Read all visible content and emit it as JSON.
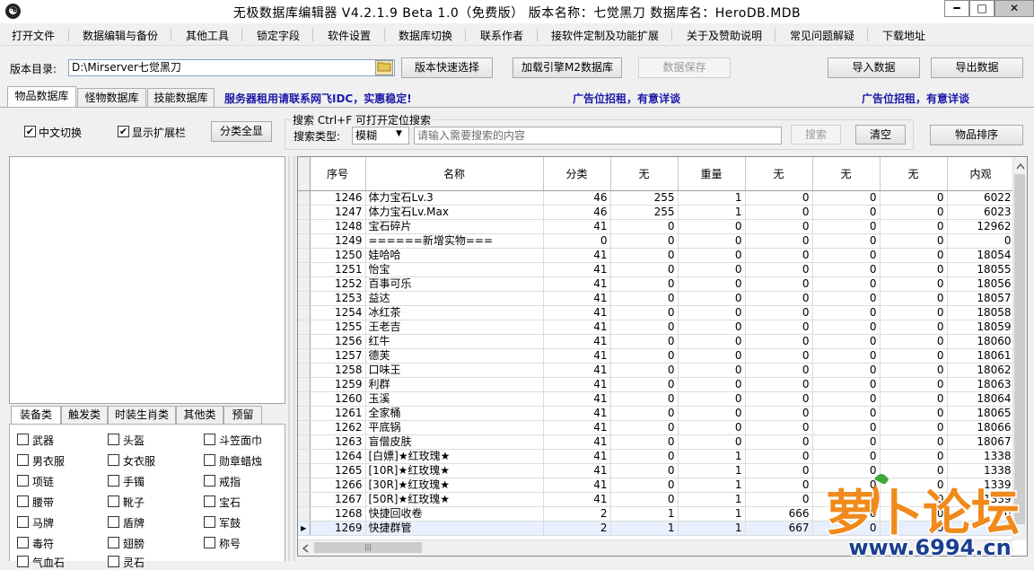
{
  "window": {
    "title": "无极数据库编辑器 V4.2.1.9    Beta 1.0（免费版）    版本名称：七觉黑刀    数据库名：HeroDB.MDB",
    "icon_char": "☯",
    "minimize": "━",
    "maximize": "□",
    "close": "✕"
  },
  "menu": [
    "打开文件",
    "数据编辑与备份",
    "其他工具",
    "锁定字段",
    "软件设置",
    "数据库切换",
    "联系作者",
    "接软件定制及功能扩展",
    "关于及赞助说明",
    "常见问题解疑",
    "下载地址"
  ],
  "toolbar": {
    "dir_label": "版本目录:",
    "dir_value": "D:\\Mirserver七觉黑刀",
    "quick_select": "版本快速选择",
    "load_engine": "加载引擎M2数据库",
    "save_data": "数据保存",
    "import_data": "导入数据",
    "export_data": "导出数据"
  },
  "tabs": [
    "物品数据库",
    "怪物数据库",
    "技能数据库"
  ],
  "ads": [
    "服务器租用请联系网飞IDC，实惠稳定!",
    "广告位招租，有意详谈",
    "广告位招租，有意详谈"
  ],
  "options": {
    "chinese_switch": "中文切换",
    "show_ext": "显示扩展栏",
    "show_all": "分类全显",
    "check_mark": "✔"
  },
  "search": {
    "legend": "搜索  Ctrl+F 可打开定位搜索",
    "type_label": "搜索类型:",
    "type_value": "模糊",
    "placeholder": "请输入需要搜索的内容",
    "search_button": "搜索",
    "clear_button": "清空",
    "sort_button": "物品排序"
  },
  "category_tabs": [
    "装备类",
    "触发类",
    "时装生肖类",
    "其他类",
    "预留"
  ],
  "categories": [
    "武器",
    "头盔",
    "斗笠面巾",
    "男衣服",
    "女衣服",
    "勋章蜡烛",
    "项链",
    "手镯",
    "戒指",
    "腰带",
    "靴子",
    "宝石",
    "马牌",
    "盾牌",
    "军鼓",
    "毒符",
    "翅膀",
    "称号",
    "气血石",
    "灵石"
  ],
  "grid": {
    "columns": [
      "序号",
      "名称",
      "分类",
      "无",
      "重量",
      "无",
      "无",
      "无",
      "内观"
    ],
    "selected_row_marker": "▶",
    "rows": [
      [
        "1246",
        "体力宝石Lv.3",
        "46",
        "255",
        "1",
        "0",
        "0",
        "0",
        "6022"
      ],
      [
        "1247",
        "体力宝石Lv.Max",
        "46",
        "255",
        "1",
        "0",
        "0",
        "0",
        "6023"
      ],
      [
        "1248",
        "宝石碎片",
        "41",
        "0",
        "0",
        "0",
        "0",
        "0",
        "12962"
      ],
      [
        "1249",
        "======新增实物===",
        "0",
        "0",
        "0",
        "0",
        "0",
        "0",
        "0"
      ],
      [
        "1250",
        "娃哈哈",
        "41",
        "0",
        "0",
        "0",
        "0",
        "0",
        "18054"
      ],
      [
        "1251",
        "怡宝",
        "41",
        "0",
        "0",
        "0",
        "0",
        "0",
        "18055"
      ],
      [
        "1252",
        "百事可乐",
        "41",
        "0",
        "0",
        "0",
        "0",
        "0",
        "18056"
      ],
      [
        "1253",
        "益达",
        "41",
        "0",
        "0",
        "0",
        "0",
        "0",
        "18057"
      ],
      [
        "1254",
        "冰红茶",
        "41",
        "0",
        "0",
        "0",
        "0",
        "0",
        "18058"
      ],
      [
        "1255",
        "王老吉",
        "41",
        "0",
        "0",
        "0",
        "0",
        "0",
        "18059"
      ],
      [
        "1256",
        "红牛",
        "41",
        "0",
        "0",
        "0",
        "0",
        "0",
        "18060"
      ],
      [
        "1257",
        "德芙",
        "41",
        "0",
        "0",
        "0",
        "0",
        "0",
        "18061"
      ],
      [
        "1258",
        "口味王",
        "41",
        "0",
        "0",
        "0",
        "0",
        "0",
        "18062"
      ],
      [
        "1259",
        "利群",
        "41",
        "0",
        "0",
        "0",
        "0",
        "0",
        "18063"
      ],
      [
        "1260",
        "玉溪",
        "41",
        "0",
        "0",
        "0",
        "0",
        "0",
        "18064"
      ],
      [
        "1261",
        "全家桶",
        "41",
        "0",
        "0",
        "0",
        "0",
        "0",
        "18065"
      ],
      [
        "1262",
        "平底锅",
        "41",
        "0",
        "0",
        "0",
        "0",
        "0",
        "18066"
      ],
      [
        "1263",
        "盲僧皮肤",
        "41",
        "0",
        "0",
        "0",
        "0",
        "0",
        "18067"
      ],
      [
        "1264",
        "[白嫖]★红玫瑰★",
        "41",
        "0",
        "1",
        "0",
        "0",
        "0",
        "1338"
      ],
      [
        "1265",
        "[10R]★红玫瑰★",
        "41",
        "0",
        "1",
        "0",
        "0",
        "0",
        "1338"
      ],
      [
        "1266",
        "[30R]★红玫瑰★",
        "41",
        "0",
        "1",
        "0",
        "0",
        "0",
        "1339"
      ],
      [
        "1267",
        "[50R]★红玫瑰★",
        "41",
        "0",
        "1",
        "0",
        "0",
        "0",
        "1339"
      ],
      [
        "1268",
        "快捷回收卷",
        "2",
        "1",
        "1",
        "666",
        "0",
        "0",
        "0"
      ],
      [
        "1269",
        "快捷群管",
        "2",
        "1",
        "1",
        "667",
        "0",
        "0",
        "0"
      ]
    ]
  },
  "watermark": {
    "logo_text": "萝卜论坛",
    "url": "www.6994.cn"
  },
  "colors": {
    "ad_text": "#1a1aa8",
    "watermark_orange": "#f08a1c",
    "watermark_blue": "#1a3f8f"
  }
}
